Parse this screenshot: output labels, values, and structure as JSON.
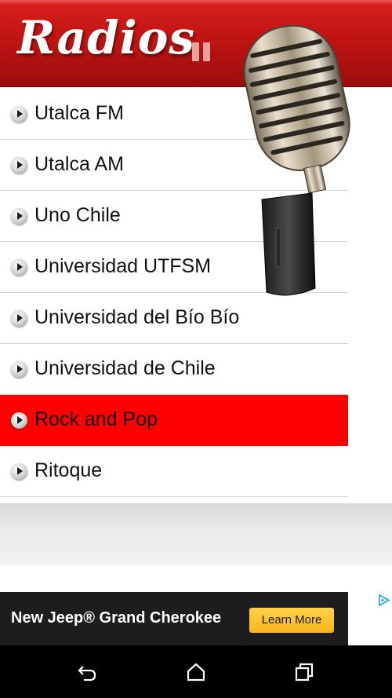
{
  "header": {
    "title": "Radios"
  },
  "stations": [
    {
      "label": "Utalca FM",
      "active": false
    },
    {
      "label": "Utalca AM",
      "active": false
    },
    {
      "label": "Uno Chile",
      "active": false
    },
    {
      "label": "Universidad UTFSM",
      "active": false
    },
    {
      "label": "Universidad del Bío Bío",
      "active": false
    },
    {
      "label": "Universidad de Chile",
      "active": false
    },
    {
      "label": "Rock and Pop",
      "active": true
    },
    {
      "label": "Ritoque",
      "active": false
    }
  ],
  "ad": {
    "text": "New Jeep® Grand Cherokee",
    "button_label": "Learn More"
  },
  "icons": {
    "pause": "pause-icon",
    "play": "play-icon",
    "microphone": "microphone-image",
    "adchoices": "adchoices-icon",
    "back": "back-icon",
    "home": "home-icon",
    "recents": "recents-icon"
  },
  "colors": {
    "header_red": "#c01414",
    "active_row": "#ff0000",
    "ad_button": "#f8b51c"
  }
}
